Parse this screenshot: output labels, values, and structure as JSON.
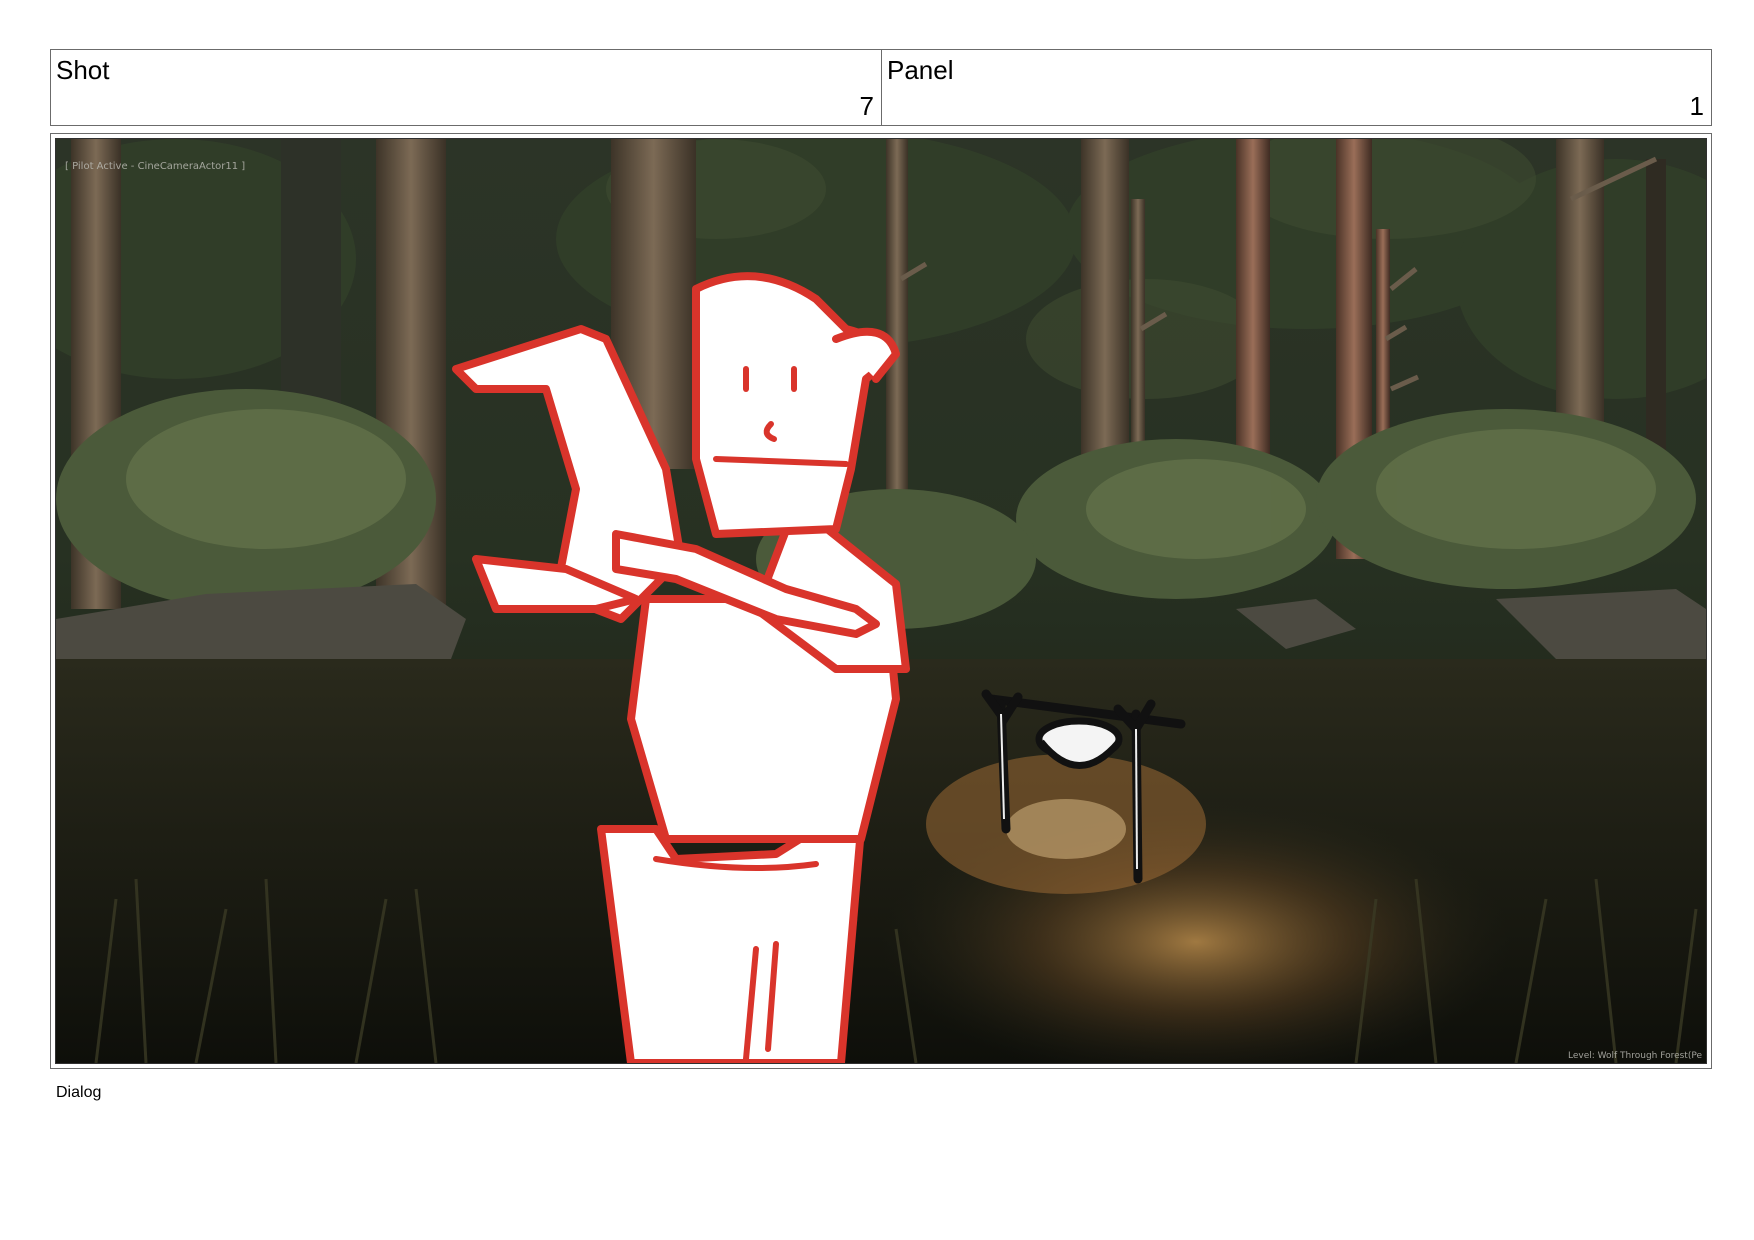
{
  "header": {
    "shot_label": "Shot",
    "shot_number": "7",
    "panel_label": "Panel",
    "panel_number": "1"
  },
  "frame": {
    "pilot_text": "[ Pilot Active - CineCameraActor11 ]",
    "level_text": "Level: Wolf Through Forest(Pe"
  },
  "dialog_label": "Dialog",
  "colors": {
    "sketch_red": "#d9342b",
    "forest_dark": "#1b1e15",
    "border": "#6b6b6b"
  }
}
